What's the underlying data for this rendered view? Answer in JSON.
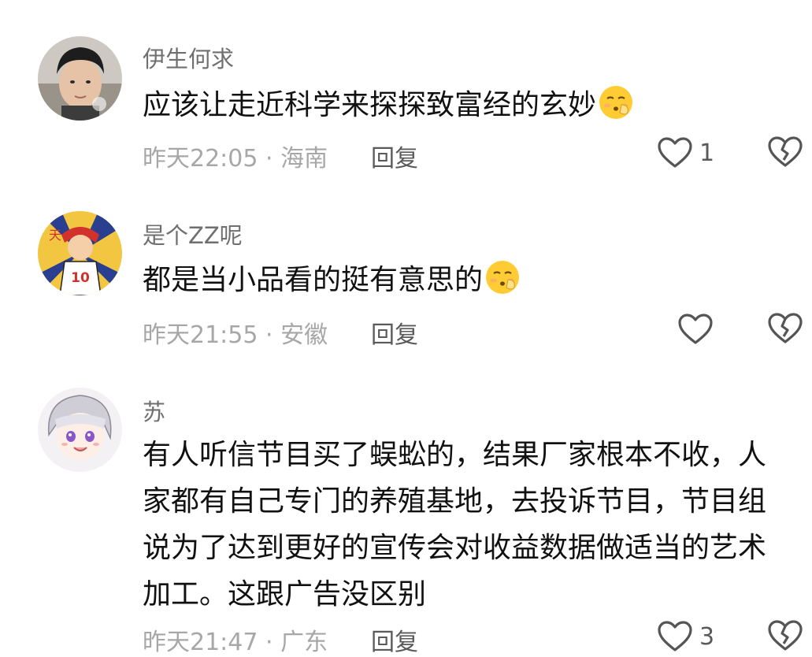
{
  "comments": [
    {
      "username": "伊生何求",
      "text": "应该让走近科学来探探致富经的玄妙",
      "emoji": "shushing-face",
      "time_location": "昨天22:05 · 海南",
      "reply_label": "回复",
      "like_count": "1"
    },
    {
      "username": "是个ZZ呢",
      "text": "都是当小品看的挺有意思的",
      "emoji": "shushing-face",
      "time_location": "昨天21:55 · 安徽",
      "reply_label": "回复",
      "like_count": ""
    },
    {
      "username": "苏",
      "text_lines": [
        "有人听信节目买了蜈蚣的，结果厂家根本不收，人",
        "家都有自己专门的养殖基地，去投诉节目，节目组",
        "说为了达到更好的宣传会对收益数据做适当的艺术",
        "加工。这跟广告没区别"
      ],
      "time_location": "昨天21:47 · 广东",
      "reply_label": "回复",
      "like_count": "3"
    }
  ],
  "icons": {
    "like": "heart-outline-icon",
    "dislike": "broken-heart-icon",
    "emoji": "shushing-face-emoji"
  },
  "colors": {
    "text": "#111111",
    "username": "#6f6f6f",
    "meta": "#a7a7a7",
    "action": "#5a5a5a",
    "icon_stroke": "#555555"
  }
}
